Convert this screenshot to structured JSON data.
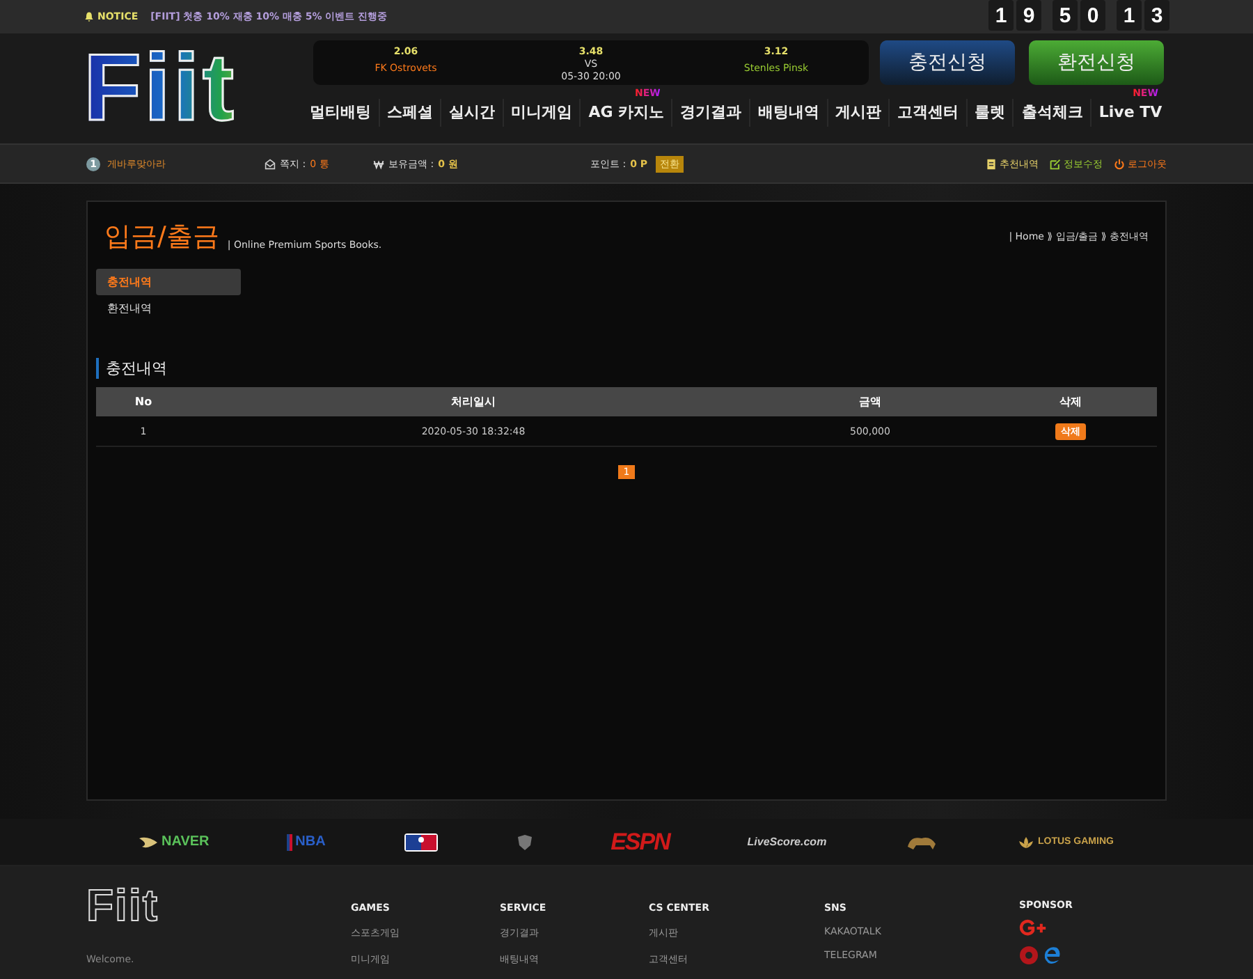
{
  "notice": {
    "label": "NOTICE",
    "text": "[FIIT] 첫충 10% 재충 10% 매충 5% 이벤트 진행중"
  },
  "counter": [
    "1",
    "9",
    "5",
    "0",
    "1",
    "3"
  ],
  "logo": "Fiit",
  "match": {
    "home_odds": "2.06",
    "home_team": "FK Ostrovets",
    "draw_odds": "3.48",
    "vs": "VS",
    "time": "05-30 20:00",
    "away_odds": "3.12",
    "away_team": "Stenles Pinsk"
  },
  "actions": [
    {
      "label": "충전신청",
      "kind": "deposit"
    },
    {
      "label": "환전신청",
      "kind": "withdraw"
    }
  ],
  "nav": [
    {
      "label": "멀티배팅"
    },
    {
      "label": "스페셜"
    },
    {
      "label": "실시간"
    },
    {
      "label": "미니게임"
    },
    {
      "label": "AG 카지노",
      "badge": "NEW"
    },
    {
      "label": "경기결과"
    },
    {
      "label": "배팅내역"
    },
    {
      "label": "게시판"
    },
    {
      "label": "고객센터"
    },
    {
      "label": "룰렛"
    },
    {
      "label": "출석체크"
    },
    {
      "label": "Live TV",
      "badge": "NEW"
    }
  ],
  "user_bar": {
    "level": "1",
    "username": "게바루맞아라",
    "messages_label": "쪽지 :",
    "messages": "0 통",
    "balance_label": "보유금액 :",
    "balance": "0 원",
    "points_label": "포인트 :",
    "points": "0 P",
    "convert": "전환",
    "links": [
      {
        "label": "추천내역",
        "kind": "referral"
      },
      {
        "label": "정보수정",
        "kind": "edit"
      },
      {
        "label": "로그아웃",
        "kind": "logout"
      }
    ]
  },
  "page": {
    "title": "입금/출금",
    "subtitle": "| Online Premium Sports Books.",
    "breadcrumb": "| Home ⟫ 입금/출금 ⟫ 충전내역",
    "subtabs": [
      {
        "label": "충전내역",
        "selected": true
      },
      {
        "label": "환전내역",
        "selected": false
      }
    ],
    "section_title": "충전내역",
    "table": {
      "columns": [
        "No",
        "처리일시",
        "금액",
        "삭제"
      ],
      "rows": [
        {
          "no": "1",
          "date": "2020-05-30 18:32:48",
          "amount": "500,000",
          "action": "삭제"
        }
      ]
    },
    "pagination": [
      {
        "label": "1",
        "selected": true
      }
    ]
  },
  "sponsors": [
    {
      "kind": "naver",
      "label": "NAVER"
    },
    {
      "kind": "nba",
      "label": "NBA"
    },
    {
      "kind": "mlb"
    },
    {
      "kind": "nhl"
    },
    {
      "kind": "espn",
      "label": "ESPN"
    },
    {
      "kind": "livescore",
      "label": "LiveScore.com"
    },
    {
      "kind": "lion"
    },
    {
      "kind": "lotus",
      "label": "LOTUS GAMING"
    }
  ],
  "footer": {
    "logo": "Fiit",
    "welcome": "Welcome.",
    "columns": [
      {
        "title": "GAMES",
        "items": [
          "스포츠게임",
          "미니게임"
        ]
      },
      {
        "title": "SERVICE",
        "items": [
          "경기결과",
          "배팅내역"
        ]
      },
      {
        "title": "CS CENTER",
        "items": [
          "게시판",
          "고객센터"
        ]
      },
      {
        "title": "SNS",
        "items": [
          "KAKAOTALK",
          "TELEGRAM"
        ]
      }
    ],
    "sponsor_title": "SPONSOR"
  }
}
